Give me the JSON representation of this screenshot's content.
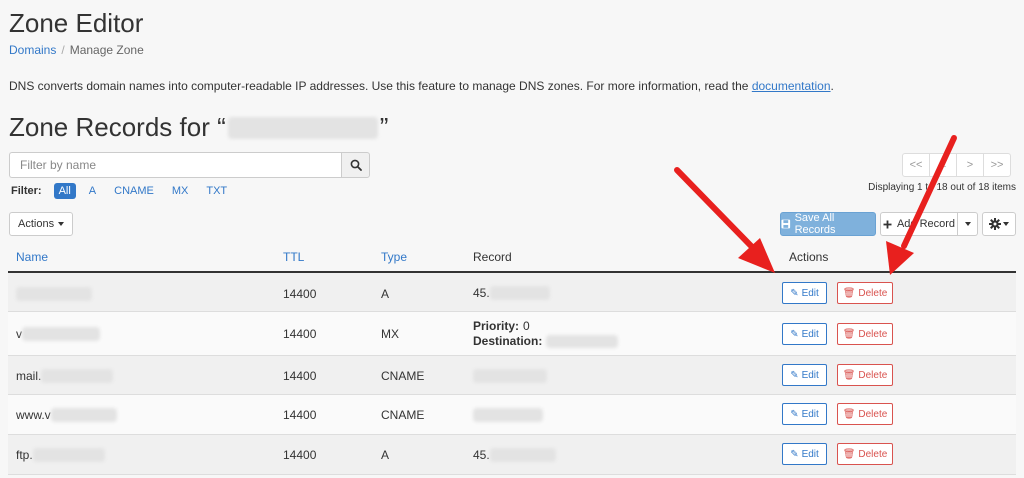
{
  "page": {
    "title": "Zone Editor",
    "breadcrumb": {
      "root": "Domains",
      "separator": "/",
      "current": "Manage Zone"
    },
    "intro_text": "DNS converts domain names into computer-readable IP addresses. Use this feature to manage DNS zones. For more information, read the ",
    "intro_link": "documentation",
    "intro_end": "."
  },
  "zone": {
    "heading_prefix": "Zone Records for “",
    "heading_suffix": "”"
  },
  "search": {
    "placeholder": "Filter by name",
    "icon": "search-icon"
  },
  "filter": {
    "label": "Filter:",
    "options": [
      "All",
      "A",
      "CNAME",
      "MX",
      "TXT"
    ],
    "active": "All"
  },
  "pagination": {
    "buttons": [
      "<<",
      "<",
      ">",
      ">>"
    ],
    "display_text": "Displaying 1 to 18 out of 18 items"
  },
  "toolbar": {
    "actions_label": "Actions",
    "save_label": "Save All Records",
    "add_label": "Add Record",
    "save_icon": "save-icon",
    "add_icon": "plus-icon",
    "gear_icon": "gear-icon"
  },
  "table": {
    "headers": {
      "name": "Name",
      "ttl": "TTL",
      "type": "Type",
      "record": "Record",
      "actions": "Actions"
    },
    "edit_label": "Edit",
    "delete_label": "Delete",
    "rows": [
      {
        "name": "",
        "ttl": "14400",
        "type": "A",
        "record": "45."
      },
      {
        "name": "v",
        "ttl": "14400",
        "type": "MX",
        "priority_label": "Priority:",
        "priority": "0",
        "destination_label": "Destination:"
      },
      {
        "name": "mail.",
        "ttl": "14400",
        "type": "CNAME",
        "record": ""
      },
      {
        "name": "www.v",
        "ttl": "14400",
        "type": "CNAME",
        "record": ""
      },
      {
        "name": "ftp.",
        "ttl": "14400",
        "type": "A",
        "record": "45."
      }
    ]
  },
  "colors": {
    "link": "#3278c8",
    "delete": "#d9534f",
    "arrow": "#e8201e",
    "save_bg": "#7fb1dc"
  }
}
